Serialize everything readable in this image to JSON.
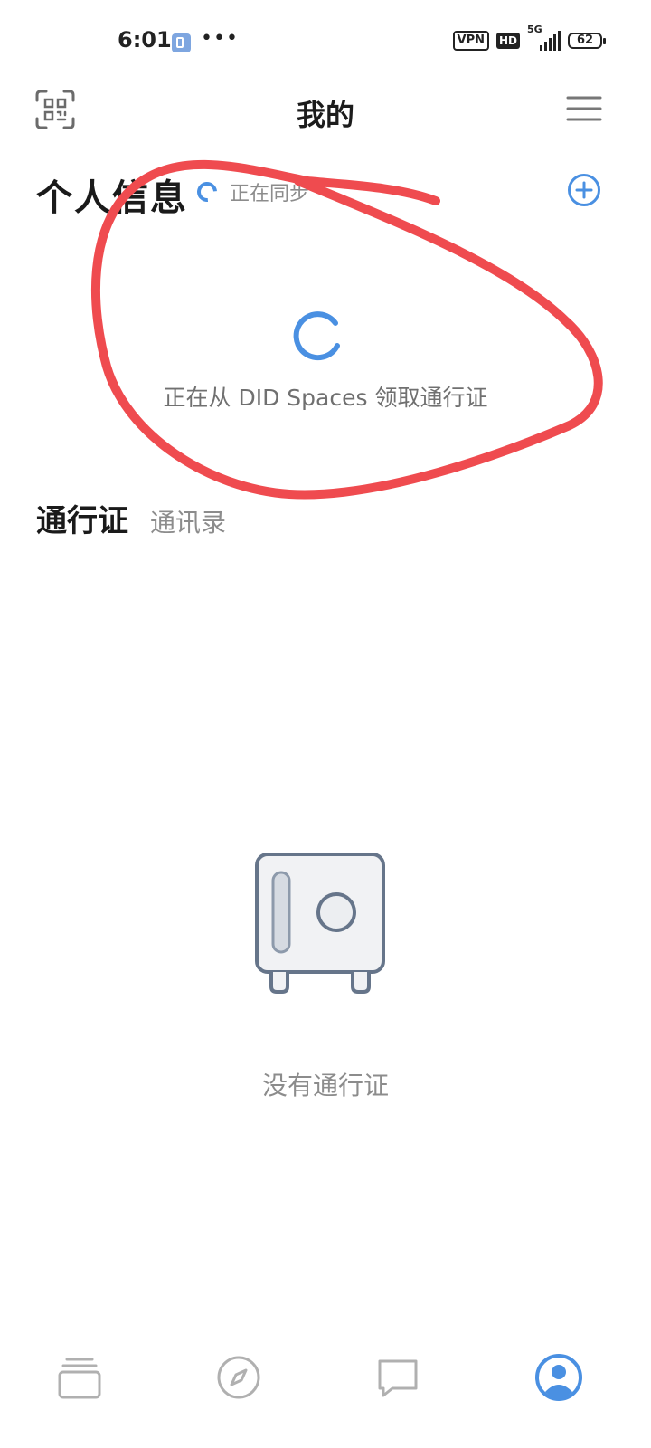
{
  "status_bar": {
    "time": "6:01",
    "dots": "•••",
    "vpn": "VPN",
    "hd": "HD",
    "network": "5G",
    "battery": "62"
  },
  "header": {
    "title": "我的",
    "scan_icon": "qr-scan-icon",
    "menu_icon": "hamburger-menu-icon"
  },
  "personal_info": {
    "title": "个人信息",
    "sync_status": "正在同步",
    "add_icon": "plus-circle-icon",
    "loading_text": "正在从 DID Spaces 领取通行证"
  },
  "tabs": [
    {
      "label": "通行证",
      "active": true
    },
    {
      "label": "通讯录",
      "active": false
    }
  ],
  "empty_state": {
    "icon": "safe-icon",
    "text": "没有通行证"
  },
  "bottom_nav": [
    {
      "icon": "cards-icon",
      "active": false
    },
    {
      "icon": "compass-icon",
      "active": false
    },
    {
      "icon": "chat-icon",
      "active": false
    },
    {
      "icon": "profile-icon",
      "active": true
    }
  ],
  "colors": {
    "accent": "#4a90e2",
    "annotation": "#ef4b4f",
    "muted_text": "#8c8c8c",
    "icon_gray": "#b0b0b0"
  }
}
